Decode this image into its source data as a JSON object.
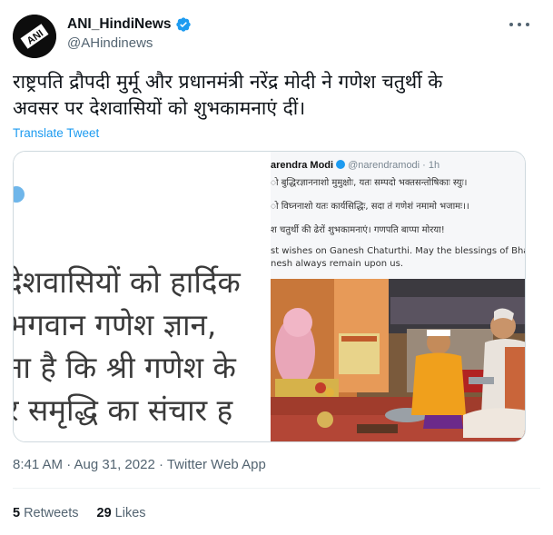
{
  "author": {
    "name": "ANI_HindiNews",
    "handle": "@AHindinews",
    "avatar_text": "ANI",
    "verified_color": "#1d9bf0"
  },
  "tweet": {
    "text_line1": "राष्ट्रपति द्रौपदी मुर्मू और प्रधानमंत्री नरेंद्र मोदी ने गणेश चतुर्थी के",
    "text_line2": "अवसर पर देशवासियों को शुभकामनाएं दीं।",
    "translate_label": "Translate Tweet"
  },
  "media": {
    "left_image_lines": [
      "देशवासियों को हार्दिक",
      "भगवान गणेश ज्ञान,",
      "ना है कि श्री गणेश के",
      "र समृद्धि  का संचार ह"
    ],
    "embedded_tweet": {
      "author_name": "arendra Modi",
      "author_handle": "@narendramodi · 1h",
      "lines": [
        "ो बुद्धिरज्ञाननाशो मुमुक्षोः, यतः सम्पदो भक्तसन्तोषिकाः स्युः।",
        "ो विघ्ननाशो यतः कार्यसिद्धिः, सदा तं गणेशं नमामो भजामः।।",
        "श चतुर्थी की ढेरों शुभकामनाएं। गणपति बाप्पा मोरया!",
        "st wishes on Ganesh Chaturthi. May the blessings of Bhagwan Sh",
        "nesh always remain upon us."
      ]
    }
  },
  "timestamp": "8:41 AM · Aug 31, 2022 · Twitter Web App",
  "stats": {
    "retweets_count": "5",
    "retweets_label": "Retweets",
    "likes_count": "29",
    "likes_label": "Likes"
  },
  "colors": {
    "link": "#1d9bf0",
    "secondary_text": "#536471",
    "border": "#cfd9de"
  }
}
